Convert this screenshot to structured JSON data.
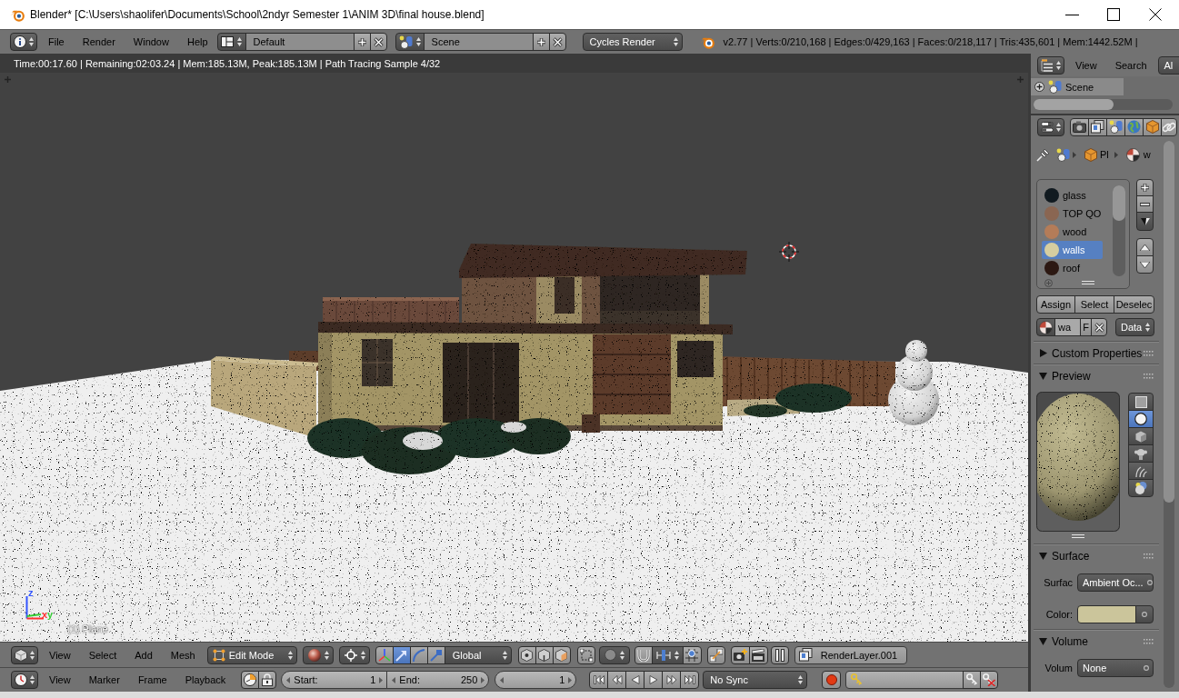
{
  "window": {
    "title": "Blender* [C:\\Users\\shaolifer\\Documents\\School\\2ndyr Semester 1\\ANIM 3D\\final house.blend]"
  },
  "info_header": {
    "menus": [
      "File",
      "Render",
      "Window",
      "Help"
    ],
    "screen_layout": "Default",
    "scene": "Scene",
    "render_engine": "Cycles Render",
    "stats": "v2.77 | Verts:0/210,168 | Edges:0/429,163 | Faces:0/218,117 | Tris:435,601 | Mem:1442.52M |"
  },
  "viewport": {
    "render_status": "Time:00:17.60 | Remaining:02:03.24 | Mem:185.13M, Peak:185.13M | Path Tracing Sample 4/32",
    "axes": [
      {
        "label": "z",
        "color": "#3355ff"
      },
      {
        "label": "x",
        "color": "#ff3030"
      },
      {
        "label": "y",
        "color": "#33cc33"
      }
    ],
    "object_info": "(1) Plane"
  },
  "viewport_header": {
    "menus": [
      "View",
      "Select",
      "Add",
      "Mesh"
    ],
    "mode": "Edit Mode",
    "manipulators": [
      {
        "kind": "toggle",
        "selected": false
      },
      {
        "kind": "translate",
        "selected": true
      },
      {
        "kind": "rotate",
        "selected": false
      },
      {
        "kind": "scale",
        "selected": false
      }
    ],
    "orientation": "Global",
    "render_layer": "RenderLayer.001"
  },
  "timeline_header": {
    "menus": [
      "View",
      "Marker",
      "Frame",
      "Playback"
    ],
    "frame_fields": [
      {
        "label": "Start:",
        "value": "1"
      },
      {
        "label": "End:",
        "value": "250"
      }
    ],
    "current_frame": "1",
    "sync": "No Sync"
  },
  "outliner": {
    "menus": [
      "View",
      "Search"
    ],
    "display_mode": "Al",
    "items": [
      {
        "label": "Scene",
        "expanded": false
      }
    ]
  },
  "properties": {
    "breadcrumb": [
      "Pl",
      "w"
    ],
    "material_slots": [
      {
        "name": "glass",
        "color": "#111a20",
        "selected": false
      },
      {
        "name": "TOP QO",
        "color": "#8a6652",
        "selected": false
      },
      {
        "name": "wood",
        "color": "#b47c58",
        "selected": false
      },
      {
        "name": "walls",
        "color": "#d6cea0",
        "selected": true
      },
      {
        "name": "roof",
        "color": "#2c1812",
        "selected": false
      }
    ],
    "slot_actions": [
      "Assign",
      "Select",
      "Deselec"
    ],
    "material": {
      "name": "wa",
      "fake_user": "F",
      "link": "Data"
    },
    "panels": [
      {
        "title": "Custom Properties",
        "expanded": false
      },
      {
        "kind": "preview",
        "title": "Preview",
        "expanded": true,
        "preview_types": [
          {
            "kind": "plane",
            "selected": false
          },
          {
            "kind": "sphere",
            "selected": true
          },
          {
            "kind": "cube",
            "selected": false
          },
          {
            "kind": "monkey",
            "selected": false
          },
          {
            "kind": "hair",
            "selected": false
          },
          {
            "kind": "sky",
            "selected": false
          }
        ]
      },
      {
        "kind": "fields",
        "title": "Surface",
        "expanded": true,
        "fields": [
          {
            "kind": "menu",
            "label": "Surfac",
            "value": "Ambient Oc..."
          },
          {
            "kind": "color",
            "label": "Color:",
            "color": "#cbc59b"
          }
        ]
      },
      {
        "kind": "fields",
        "title": "Volume",
        "expanded": true,
        "fields": [
          {
            "kind": "menu",
            "label": "Volum",
            "value": "None"
          }
        ]
      }
    ]
  }
}
